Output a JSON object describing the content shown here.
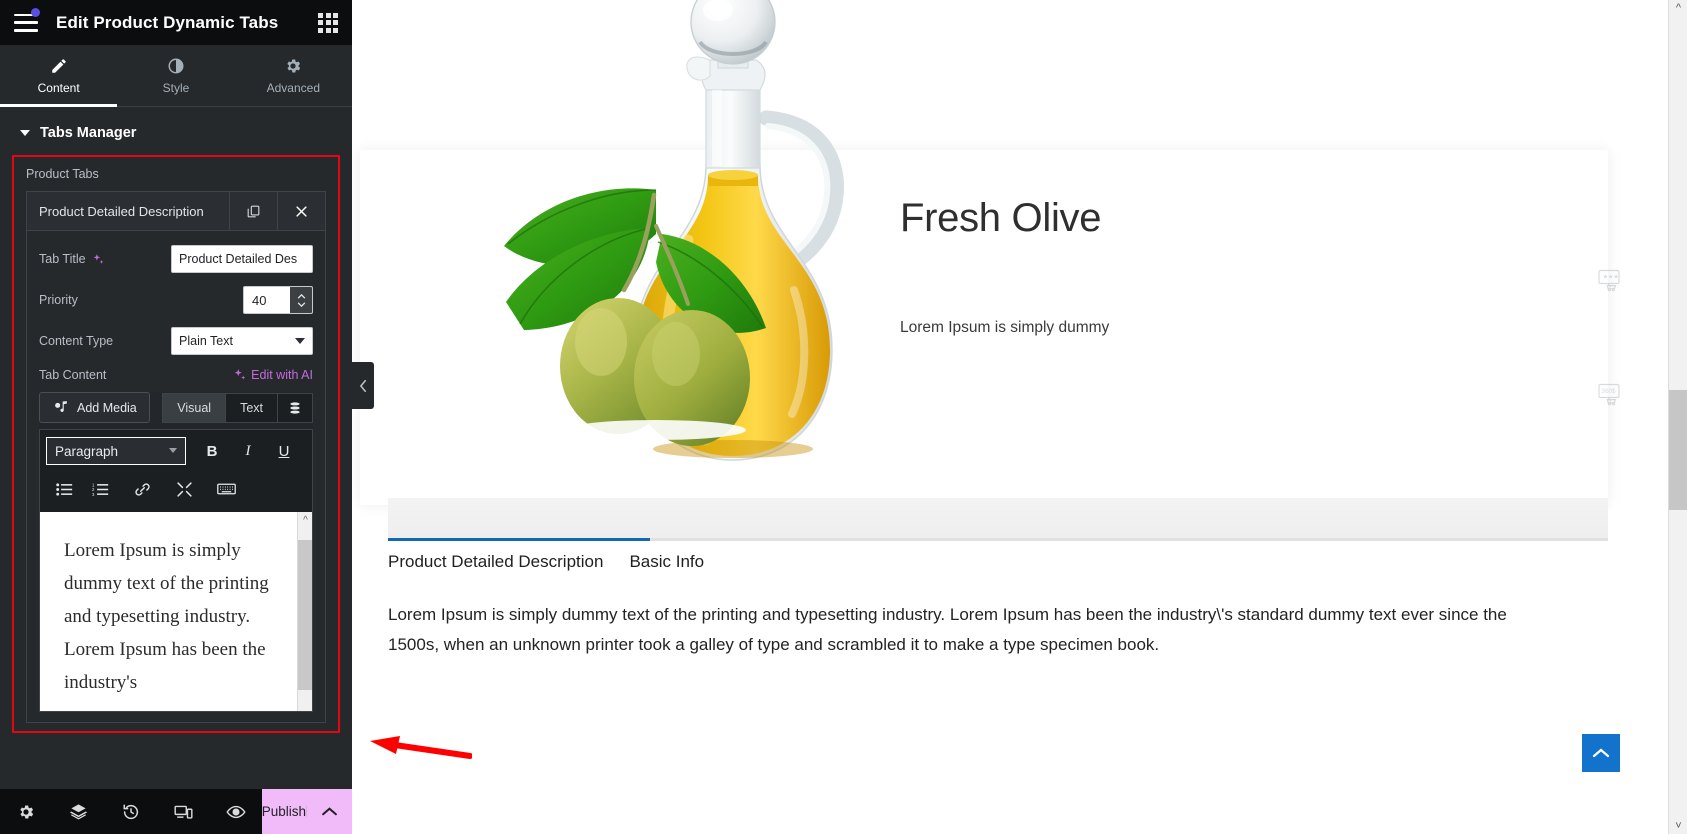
{
  "panel": {
    "header": {
      "title": "Edit Product Dynamic Tabs",
      "menu_icon": "hamburger-icon",
      "apps_icon": "apps-grid-icon"
    },
    "tabs": [
      {
        "label": "Content",
        "icon": "pencil-icon",
        "active": true
      },
      {
        "label": "Style",
        "icon": "half-circle-icon",
        "active": false
      },
      {
        "label": "Advanced",
        "icon": "gear-icon",
        "active": false
      }
    ],
    "section": {
      "title": "Tabs Manager"
    },
    "repeater": {
      "label": "Product Tabs",
      "item_title": "Product Detailed Description",
      "duplicate_icon": "copy-icon",
      "remove_icon": "close-icon"
    },
    "fields": {
      "tab_title_label": "Tab Title",
      "tab_title_ai_icon": "ai-sparkle-icon",
      "tab_title_value": "Product Detailed Des",
      "priority_label": "Priority",
      "priority_value": "40",
      "content_type_label": "Content Type",
      "content_type_value": "Plain Text",
      "content_type_options": [
        "Plain Text"
      ],
      "tab_content_label": "Tab Content",
      "edit_with_ai": "Edit with AI"
    },
    "editor": {
      "add_media": "Add Media",
      "mode_visual": "Visual",
      "mode_text": "Text",
      "db_icon": "database-icon",
      "format_value": "Paragraph",
      "format_options": [
        "Paragraph"
      ],
      "bold": "B",
      "italic": "I",
      "underline": "U",
      "toolbar_icons": [
        "bulleted-list-icon",
        "numbered-list-icon",
        "link-icon",
        "fullscreen-icon",
        "keyboard-icon"
      ],
      "content": "Lorem Ipsum is simply dummy text of the printing and typesetting industry. Lorem Ipsum has been the industry's"
    },
    "footer": {
      "icons": [
        "settings-gear-icon",
        "layers-icon",
        "history-icon",
        "responsive-mode-icon",
        "preview-eye-icon"
      ],
      "publish_label": "Publish",
      "publish_caret": "chevron-up-icon"
    },
    "collapse_icon": "chevron-left-icon"
  },
  "preview": {
    "product": {
      "title": "Fresh Olive",
      "subtitle": "Lorem Ipsum is simply dummy",
      "image_alt": "olive-oil-bottle-with-olives"
    },
    "placeholder_widgets": [
      {
        "name": "product-rating-widget-placeholder",
        "label": "★★★"
      },
      {
        "name": "product-price-widget-placeholder",
        "label": "360$"
      }
    ],
    "tabs": [
      {
        "label": "Product Detailed Description",
        "active": true
      },
      {
        "label": "Basic Info",
        "active": false
      }
    ],
    "body_text": "Lorem Ipsum is simply dummy text of the printing and typesetting industry. Lorem Ipsum has been the industry\\'s standard dummy text ever since the 1500s, when an unknown printer took a galley of type and scrambled it to make a type specimen book.",
    "back_to_top_icon": "chevron-up-icon"
  },
  "colors": {
    "panel_bg": "#26292c",
    "panel_header_bg": "#0c0d0e",
    "accent_red": "#e30613",
    "publish_pink": "#f0bbf8",
    "tab_active_blue": "#1268b3",
    "ai_purple": "#c66ae0",
    "back_top_blue": "#1272cc",
    "annotation_arrow": "#ff0000"
  }
}
